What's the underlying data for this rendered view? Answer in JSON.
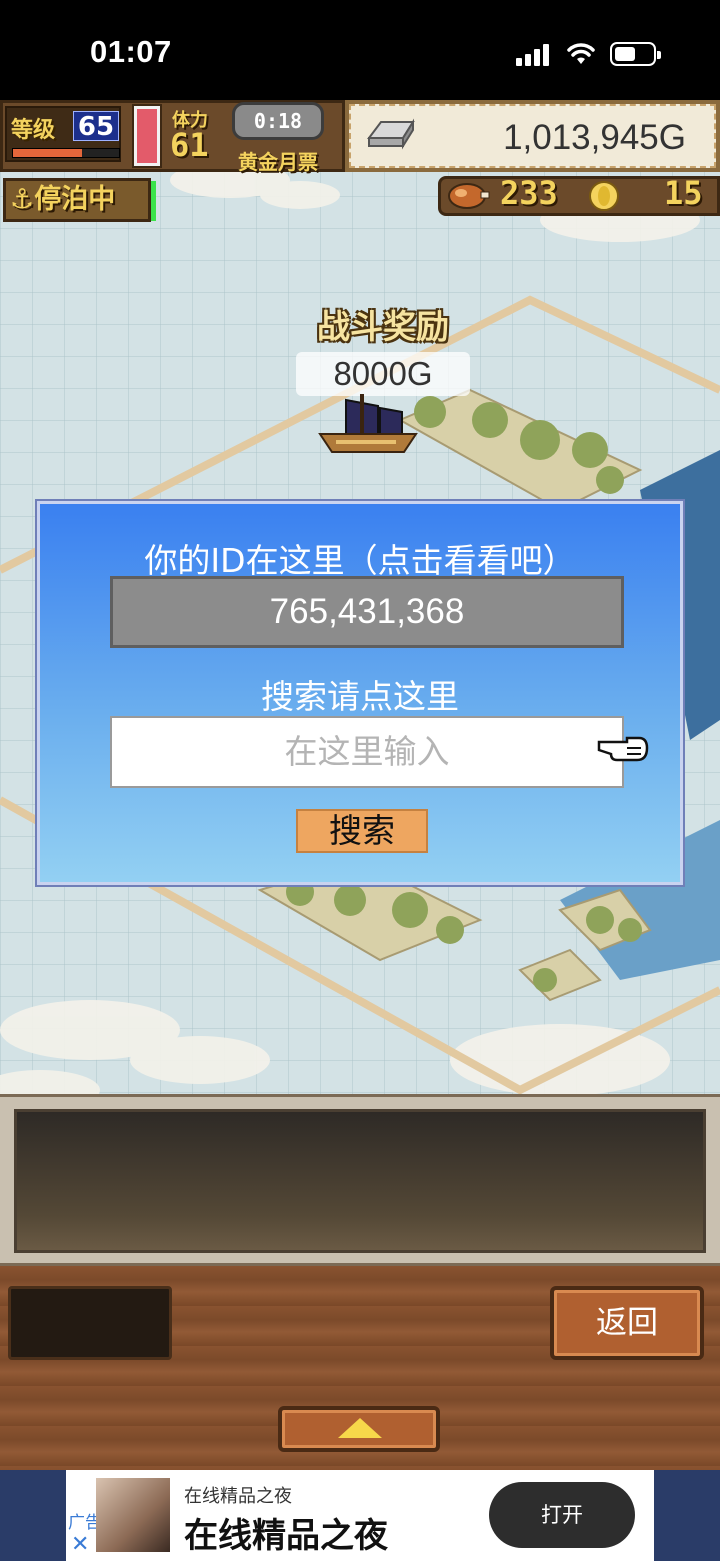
{
  "status_bar": {
    "time": "01:07"
  },
  "hud": {
    "level_label": "等级",
    "level": "65",
    "level_progress": 0.65,
    "stamina_label": "体力",
    "stamina": "61",
    "timer": "0:18",
    "pass_label": "黄金月票",
    "gold": "1,013,945G",
    "docked_label": "停泊中",
    "food": "233",
    "coins": "15"
  },
  "map": {
    "reward_title": "战斗奖励",
    "reward_value": "8000G"
  },
  "dialog": {
    "title": "你的ID在这里（点击看看吧）",
    "player_id": "765,431,368",
    "search_label": "搜索请点这里",
    "search_placeholder": "在这里输入",
    "search_button": "搜索"
  },
  "bottom": {
    "back_button": "返回"
  },
  "ad": {
    "tag": "广告",
    "close": "✕",
    "small_title": "在线精品之夜",
    "big_title": "在线精品之夜",
    "open_button": "打开"
  },
  "colors": {
    "dialog_top": "#3a80f0",
    "dialog_bottom": "#93d0f3",
    "accent_gold": "#f4d35e",
    "search_button": "#eea660"
  }
}
